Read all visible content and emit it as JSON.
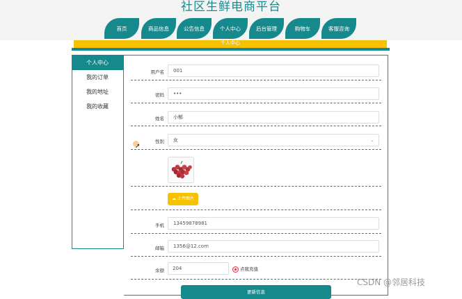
{
  "header": {
    "site_title": "社区生鲜电商平台",
    "nav": [
      "首页",
      "商品信息",
      "公告信息",
      "个人中心",
      "后台管理",
      "购物车",
      "客服咨询"
    ]
  },
  "banner": {
    "title": "个人中心"
  },
  "sidebar": {
    "items": [
      {
        "label": "个人中心",
        "active": true
      },
      {
        "label": "我的订单",
        "active": false
      },
      {
        "label": "我的地址",
        "active": false
      },
      {
        "label": "我的收藏",
        "active": false
      }
    ]
  },
  "form": {
    "username_label": "用户名",
    "username_value": "001",
    "password_label": "密码",
    "password_value": "•••",
    "name_label": "姓名",
    "name_value": "小郁",
    "gender_label": "性别",
    "gender_value": "女",
    "upload_label": "上传图片",
    "phone_label": "手机",
    "phone_value": "13459878981",
    "email_label": "邮箱",
    "email_value": "1356@12.com",
    "balance_label": "余额",
    "balance_value": "204",
    "recharge_label": "点我充值",
    "update_label": "更新信息"
  },
  "watermark": "CSDN @邻居科技",
  "colors": {
    "teal": "#15898c",
    "yellow": "#f5c100"
  }
}
